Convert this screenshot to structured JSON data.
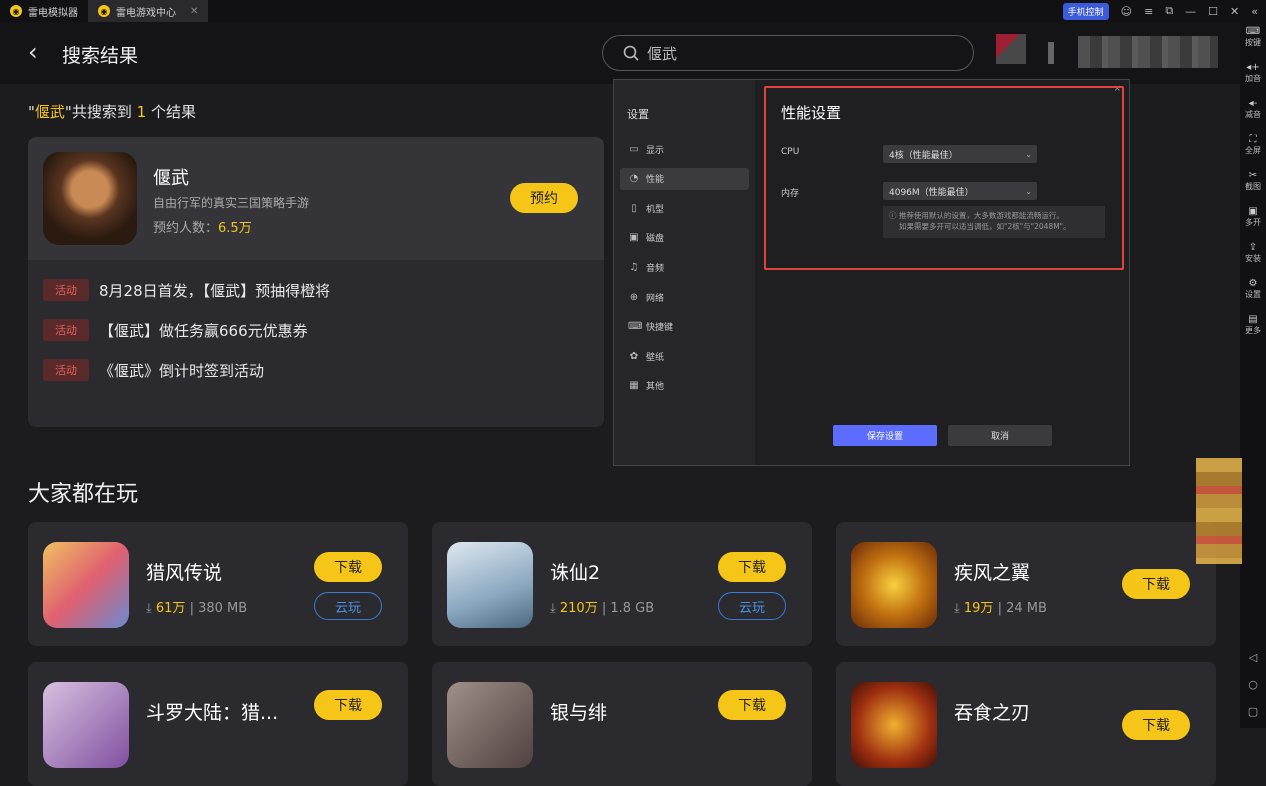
{
  "tabs": [
    {
      "label": "雷电模拟器"
    },
    {
      "label": "雷电游戏中心"
    }
  ],
  "titlebar": {
    "phone_control": "手机控制"
  },
  "header": {
    "title": "搜索结果",
    "search_value": "偃武"
  },
  "sidebar": [
    {
      "icon": "keyboard-icon",
      "label": "按键"
    },
    {
      "icon": "volume-up-icon",
      "label": "加音"
    },
    {
      "icon": "volume-down-icon",
      "label": "减音"
    },
    {
      "icon": "fullscreen-icon",
      "label": "全屏"
    },
    {
      "icon": "scissors-icon",
      "label": "截图"
    },
    {
      "icon": "multi-window-icon",
      "label": "多开"
    },
    {
      "icon": "install-icon",
      "label": "安装"
    },
    {
      "icon": "gear-icon",
      "label": "设置"
    },
    {
      "icon": "more-icon",
      "label": "更多"
    }
  ],
  "result": {
    "quote_open": "\"",
    "keyword": "偃武",
    "quote_close": "\"",
    "mid": "共搜索到",
    "count": "1",
    "suffix": "个结果"
  },
  "game": {
    "name": "偃武",
    "desc": "自由行军的真实三国策略手游",
    "reserve_label": "预约人数：",
    "reserve_count": "6.5万",
    "reserve_button": "预约",
    "activities": [
      {
        "badge": "活动",
        "text": "8月28日首发，【偃武】预抽得橙将"
      },
      {
        "badge": "活动",
        "text": "【偃武】做任务赢666元优惠券"
      },
      {
        "badge": "活动",
        "text": "《偃武》倒计时签到活动"
      }
    ]
  },
  "section_title": "大家都在玩",
  "cards": [
    {
      "name": "猎风传说",
      "downloads": "61万",
      "size": "380 MB",
      "download": "下载",
      "cloud": "云玩"
    },
    {
      "name": "诛仙2",
      "downloads": "210万",
      "size": "1.8 GB",
      "download": "下载",
      "cloud": "云玩"
    },
    {
      "name": "疾风之翼",
      "downloads": "19万",
      "size": "24 MB",
      "download": "下载"
    },
    {
      "name": "斗罗大陆：猎...",
      "download": "下载"
    },
    {
      "name": "银与绯",
      "download": "下载"
    },
    {
      "name": "吞食之刃",
      "download": "下载"
    }
  ],
  "settings": {
    "title": "设置",
    "nav": [
      {
        "icon": "monitor-icon",
        "label": "显示"
      },
      {
        "icon": "performance-icon",
        "label": "性能"
      },
      {
        "icon": "phone-model-icon",
        "label": "机型"
      },
      {
        "icon": "disk-icon",
        "label": "磁盘"
      },
      {
        "icon": "audio-icon",
        "label": "音频"
      },
      {
        "icon": "globe-icon",
        "label": "网络"
      },
      {
        "icon": "shortcut-icon",
        "label": "快捷键"
      },
      {
        "icon": "wallpaper-icon",
        "label": "壁纸"
      },
      {
        "icon": "grid-icon",
        "label": "其他"
      }
    ],
    "panel_title": "性能设置",
    "cpu_label": "CPU",
    "cpu_value": "4核（性能最佳）",
    "mem_label": "内存",
    "mem_value": "4096M（性能最佳）",
    "tip_line1": "推荐使用默认的设置，大多数游戏都能流畅运行。",
    "tip_line2": "如果需要多开可以适当调低，如\"2核\"与\"2048M\"。",
    "save": "保存设置",
    "cancel": "取消"
  }
}
